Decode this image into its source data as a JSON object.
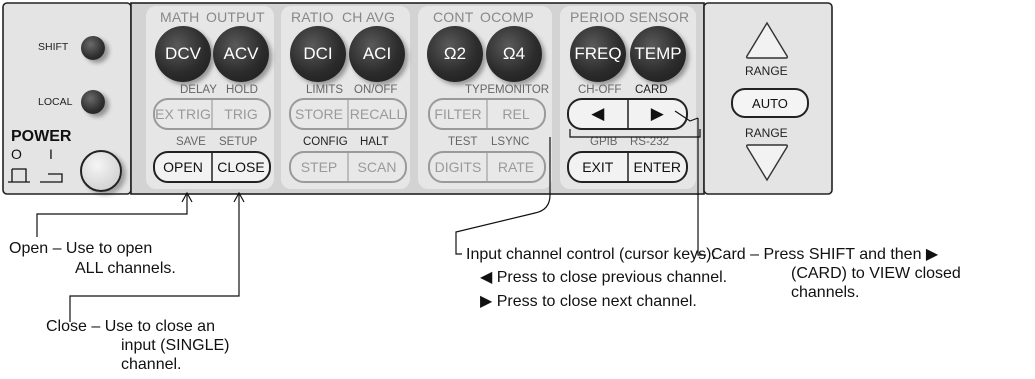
{
  "left": {
    "shift_label": "SHIFT",
    "local_label": "LOCAL",
    "power_label": "POWER",
    "power_off_symbol": "O",
    "power_on_symbol": "I"
  },
  "top_row": {
    "shift_labels": [
      "MATH",
      "OUTPUT",
      "RATIO",
      "CH AVG",
      "CONT",
      "OCOMP",
      "PERIOD",
      "SENSOR"
    ],
    "buttons": [
      "DCV",
      "ACV",
      "DCI",
      "ACI",
      "Ω2",
      "Ω4",
      "FREQ",
      "TEMP"
    ]
  },
  "middle_row": {
    "shift_labels": [
      "DELAY",
      "HOLD",
      "LIMITS",
      "ON/OFF",
      "TYPE",
      "MONITOR",
      "CH-OFF",
      "CARD"
    ],
    "buttons": [
      "EX TRIG",
      "TRIG",
      "STORE",
      "RECALL",
      "FILTER",
      "REL"
    ],
    "cursor_left": "◀",
    "cursor_right": "▶"
  },
  "bottom_row": {
    "shift_labels": [
      "SAVE",
      "SETUP",
      "CONFIG",
      "HALT",
      "TEST",
      "LSYNC",
      "GPIB",
      "RS-232"
    ],
    "buttons": [
      "OPEN",
      "CLOSE",
      "STEP",
      "SCAN",
      "DIGITS",
      "RATE",
      "EXIT",
      "ENTER"
    ]
  },
  "range": {
    "range_up_label": "RANGE",
    "auto_label": "AUTO",
    "range_down_label": "RANGE"
  },
  "annotations": {
    "open": [
      "Open – Use to open",
      "ALL channels."
    ],
    "close": [
      "Close – Use to close an",
      "input (SINGLE)",
      "channel."
    ],
    "cursor": [
      "Input channel control (cursor keys):",
      "◀ Press to close previous channel.",
      "▶ Press to close next channel."
    ],
    "card": [
      "Card – Press SHIFT and then ▶",
      "(CARD) to VIEW closed",
      "channels."
    ]
  }
}
